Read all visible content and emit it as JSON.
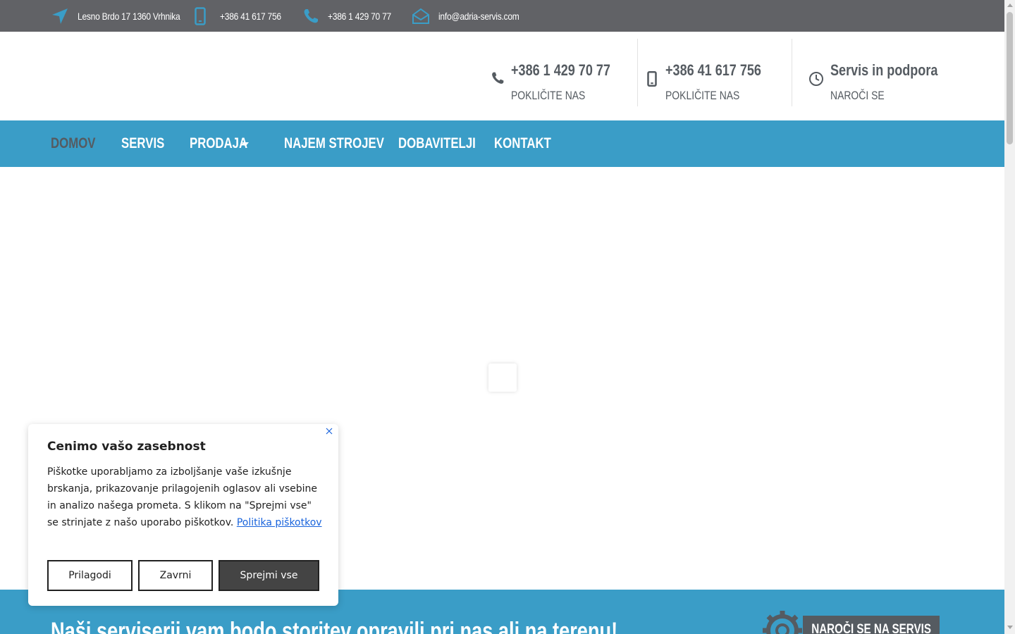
{
  "topbar": {
    "address": "Lesno Brdo 17 1360 Vrhnika",
    "mobile": "+386 41 617 756",
    "phone": "+386 1 429 70 77",
    "email": "info@adria-servis.com"
  },
  "header": {
    "boxes": [
      {
        "value": "+386 1 429 70 77",
        "caption": "POKLIČITE NAS",
        "icon": "phone-icon"
      },
      {
        "value": "+386 41 617 756",
        "caption": "POKLIČITE NAS",
        "icon": "mobile-icon"
      },
      {
        "value": "Servis in podpora",
        "caption": "NAROČI SE",
        "icon": "clock-icon"
      }
    ]
  },
  "nav": {
    "items": [
      {
        "label": "DOMOV",
        "active": true
      },
      {
        "label": "SERVIS"
      },
      {
        "label": "PRODAJA",
        "has_dropdown": true
      },
      {
        "label": "NAJEM STROJEV"
      },
      {
        "label": "DOBAVITELJI"
      },
      {
        "label": "KONTAKT"
      }
    ]
  },
  "banner": {
    "text": "Naši serviserji vam bodo storitev opravili pri nas ali na terenu!",
    "button": "NAROČI SE NA SERVIS"
  },
  "cookie": {
    "title": "Cenimo vašo zasebnost",
    "text": "Piškotke uporabljamo za izboljšanje vaše izkušnje brskanja, prikazovanje prilagojenih oglasov ali vsebine in analizo našega prometa. S klikom na \"Sprejmi vse\" se strinjate z našo uporabo piškotkov.",
    "link": "Politika piškotkov",
    "buttons": {
      "customize": "Prilagodi",
      "reject": "Zavrni",
      "accept": "Sprejmi vse"
    }
  },
  "colors": {
    "topbar": "#616266",
    "accent": "#3a9dc7",
    "dark": "#555b61",
    "link": "#1863dc"
  }
}
